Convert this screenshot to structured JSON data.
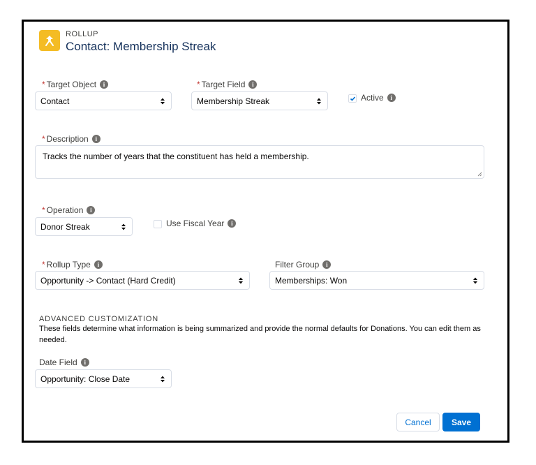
{
  "header": {
    "eyebrow": "ROLLUP",
    "title": "Contact: Membership Streak",
    "icon": "rollup-icon",
    "icon_color": "#f4bc25"
  },
  "target_object": {
    "label": "Target Object",
    "value": "Contact",
    "required": "*"
  },
  "target_field": {
    "label": "Target Field",
    "value": "Membership Streak",
    "required": "*"
  },
  "active": {
    "label": "Active",
    "checked": true
  },
  "description": {
    "label": "Description",
    "required": "*",
    "value": "Tracks the number of years that the constituent has held a membership."
  },
  "operation": {
    "label": "Operation",
    "value": "Donor Streak",
    "required": "*"
  },
  "use_fiscal_year": {
    "label": "Use Fiscal Year",
    "checked": false
  },
  "rollup_type": {
    "label": "Rollup Type",
    "value": "Opportunity -> Contact (Hard Credit)",
    "required": "*"
  },
  "filter_group": {
    "label": "Filter Group",
    "value": "Memberships: Won"
  },
  "advanced": {
    "title": "ADVANCED CUSTOMIZATION",
    "help_text": "These fields determine what information is being summarized and provide the normal defaults for Donations. You can edit them as needed."
  },
  "date_field": {
    "label": "Date Field",
    "value": "Opportunity: Close Date"
  },
  "buttons": {
    "cancel": "Cancel",
    "save": "Save"
  },
  "colors": {
    "brand": "#0070d2",
    "required": "#c23934",
    "title": "#16325c"
  }
}
